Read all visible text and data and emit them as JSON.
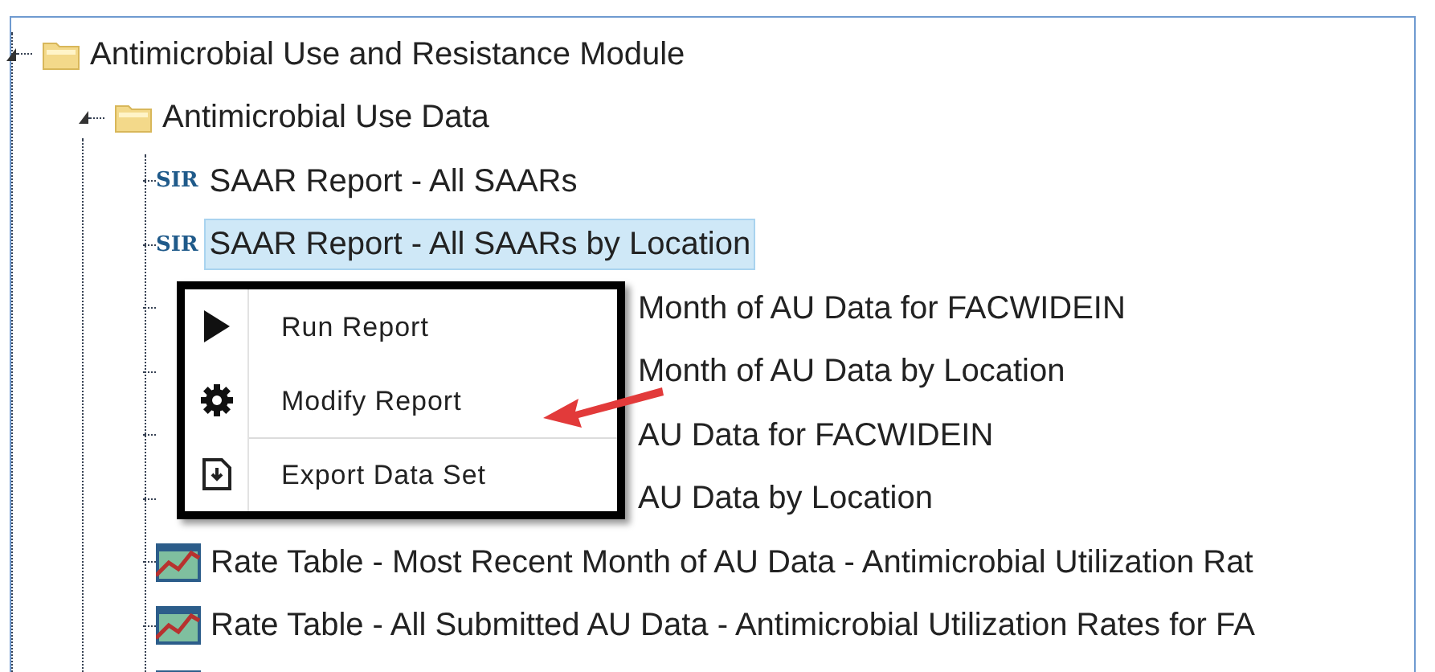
{
  "tree": {
    "label": "Antimicrobial Use and Resistance Module",
    "expanded": true,
    "children": [
      {
        "label": "Antimicrobial Use Data",
        "expanded": true,
        "children": [
          {
            "label": "SAAR Report - All SAARs",
            "kind": "sir",
            "badge": "SIR",
            "selected": false
          },
          {
            "label": "SAAR Report - All SAARs by Location",
            "kind": "sir",
            "badge": "SIR",
            "selected": true
          },
          {
            "label": "Month of AU Data for FACWIDEIN",
            "kind": "covered",
            "selected": false
          },
          {
            "label": "Month of AU Data by Location",
            "kind": "covered",
            "selected": false
          },
          {
            "label": "AU Data for FACWIDEIN",
            "kind": "covered",
            "selected": false
          },
          {
            "label": "AU Data by Location",
            "kind": "covered",
            "selected": false
          },
          {
            "label": "Rate Table - Most Recent Month of AU Data - Antimicrobial Utilization Rat",
            "kind": "rate-table",
            "selected": false
          },
          {
            "label": "Rate Table - All Submitted AU Data - Antimicrobial Utilization Rates for FA",
            "kind": "rate-table",
            "selected": false
          },
          {
            "kind": "rate-table"
          }
        ]
      }
    ]
  },
  "context_menu": {
    "items": [
      {
        "label": "Run Report",
        "kind": "run",
        "divider_above": false
      },
      {
        "label": "Modify Report",
        "kind": "modify",
        "divider_above": false
      },
      {
        "label": "Export Data Set",
        "kind": "export",
        "divider_above": true
      }
    ]
  }
}
